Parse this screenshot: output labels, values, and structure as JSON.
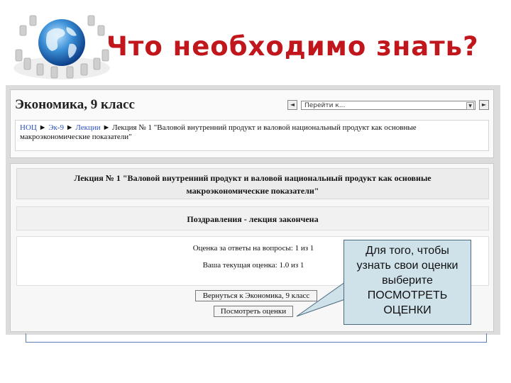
{
  "slide": {
    "title": "Что необходимо знать?"
  },
  "course_page": {
    "course_title": "Экономика, 9 класс",
    "jump_select": {
      "value": "Перейти к..."
    },
    "breadcrumb": {
      "items": [
        "НОЦ",
        "Эк-9",
        "Лекции"
      ],
      "separator": "►",
      "current": "Лекция № 1 \"Валовой внутренний продукт и валовой национальный продукт как основные макроэкономические показатели\""
    },
    "lecture_heading": {
      "line1": "Лекция № 1 \"Валовой внутренний продукт и валовой национальный продукт как основные",
      "line2": "макроэкономические показатели\""
    },
    "congrats": "Поздравления - лекция закончена",
    "grades": {
      "answers_line": "Оценка за ответы на вопросы: 1 из 1",
      "current_line": "Ваша текущая оценка: 1.0 из 1"
    },
    "buttons": {
      "return_label": "Вернуться к Экономика, 9 класс",
      "view_grades_label": "Посмотреть оценки"
    }
  },
  "callout": {
    "lines": [
      "Для того, чтобы",
      "узнать свои оценки",
      "выберите",
      "ПОСМОТРЕТЬ",
      "ОЦЕНКИ"
    ]
  },
  "colors": {
    "title": "#c0161c",
    "callout_bg": "#cfe2ea",
    "callout_border": "#4a6a80",
    "link": "#2a52be"
  },
  "icons": {
    "logo": "globe-with-chairs-icon",
    "prev": "arrow-left-icon",
    "next": "arrow-right-icon",
    "dropdown": "chevron-down-icon"
  }
}
